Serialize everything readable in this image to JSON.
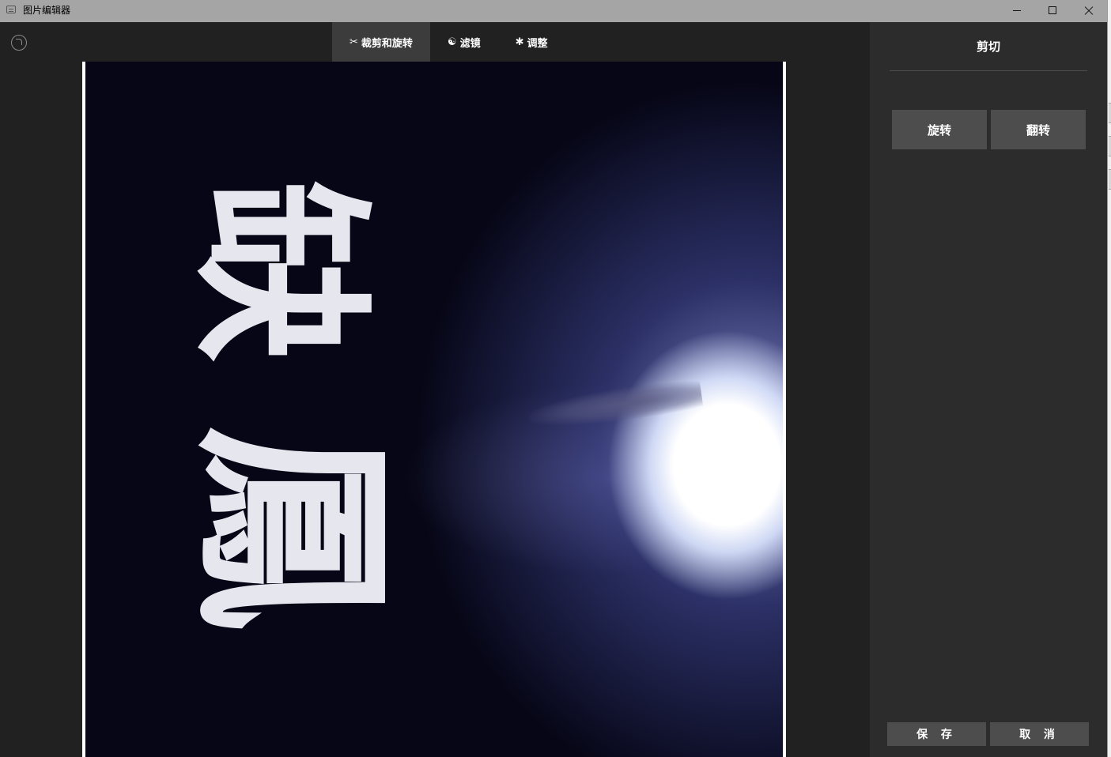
{
  "window": {
    "title": "图片编辑器"
  },
  "toolbar": {
    "tabs": [
      {
        "icon": "✂",
        "label": "裁剪和旋转"
      },
      {
        "icon": "☯",
        "label": "滤镜"
      },
      {
        "icon": "✱",
        "label": "调整"
      }
    ]
  },
  "image": {
    "big_chars": [
      "缺",
      "鳳"
    ],
    "vertical_text_1": "",
    "vertical_text_2": ""
  },
  "panel": {
    "title": "剪切",
    "rotate_label": "旋转",
    "flip_label": "翻转",
    "save_label": "保 存",
    "cancel_label": "取 消"
  },
  "colors": {
    "panel_bg": "#2c2c2c",
    "button_bg": "#4d4d4d",
    "titlebar_bg": "#a5a5a5"
  }
}
